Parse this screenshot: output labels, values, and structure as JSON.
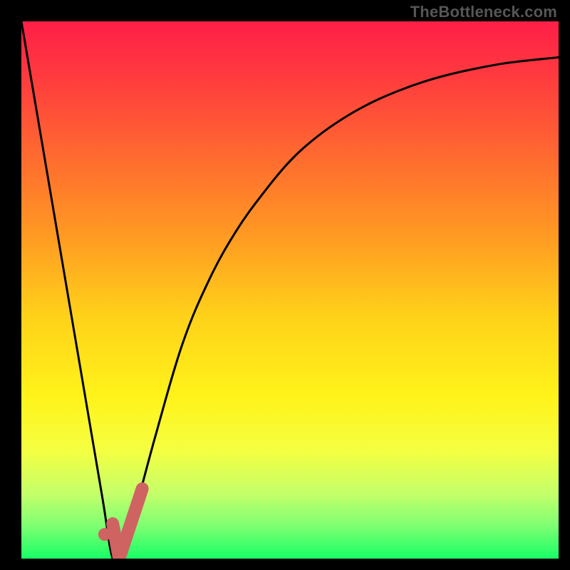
{
  "watermark": "TheBottleneck.com",
  "chart_data": {
    "type": "line",
    "title": "",
    "xlabel": "",
    "ylabel": "",
    "xlim": [
      0,
      100
    ],
    "ylim": [
      0,
      100
    ],
    "grid": false,
    "series": [
      {
        "name": "curve",
        "x": [
          0,
          5,
          10,
          15,
          17,
          19,
          21,
          25,
          30,
          35,
          40,
          45,
          50,
          55,
          60,
          65,
          70,
          75,
          80,
          85,
          90,
          95,
          100
        ],
        "y": [
          100,
          70.6,
          41.2,
          11.8,
          0,
          0,
          8,
          23,
          40,
          52,
          61,
          68,
          74,
          78.5,
          82,
          84.8,
          87,
          88.8,
          90.2,
          91.3,
          92.2,
          92.8,
          93.3
        ]
      }
    ],
    "highlight": {
      "name": "highlight-stroke",
      "color": "#cf6362",
      "x": [
        17,
        18.2,
        22.5
      ],
      "y": [
        6.5,
        0,
        13
      ]
    },
    "marker": {
      "name": "highlight-point",
      "color": "#cf6362",
      "x": 15.5,
      "y": 4.5
    },
    "gradient_stops": [
      {
        "offset": 0.0,
        "color": "#ff1f47"
      },
      {
        "offset": 0.1,
        "color": "#ff3a3f"
      },
      {
        "offset": 0.25,
        "color": "#ff6a30"
      },
      {
        "offset": 0.4,
        "color": "#ff9a22"
      },
      {
        "offset": 0.55,
        "color": "#ffd21a"
      },
      {
        "offset": 0.7,
        "color": "#fff31a"
      },
      {
        "offset": 0.8,
        "color": "#f4ff42"
      },
      {
        "offset": 0.88,
        "color": "#c3ff6a"
      },
      {
        "offset": 0.94,
        "color": "#7dff72"
      },
      {
        "offset": 1.0,
        "color": "#18ff66"
      }
    ]
  }
}
